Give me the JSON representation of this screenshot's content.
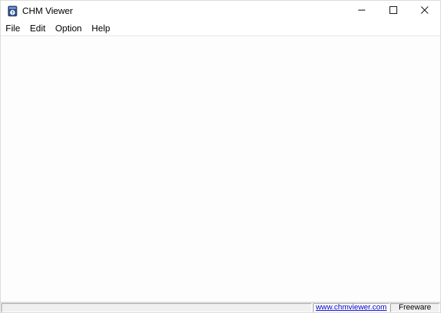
{
  "window": {
    "title": "CHM Viewer",
    "app_icon": "chm-help-book-icon",
    "controls": {
      "minimize_icon": "minimize-icon",
      "maximize_icon": "maximize-icon",
      "close_icon": "close-icon"
    }
  },
  "menubar": {
    "items": [
      {
        "label": "File"
      },
      {
        "label": "Edit"
      },
      {
        "label": "Option"
      },
      {
        "label": "Help"
      }
    ]
  },
  "statusbar": {
    "main_text": "",
    "link_text": "www.chmviewer.com",
    "license_text": "Freeware"
  },
  "colors": {
    "link": "#0000cc",
    "statusbar_bg": "#f0f0f0",
    "client_bg": "#fdfdfd"
  }
}
